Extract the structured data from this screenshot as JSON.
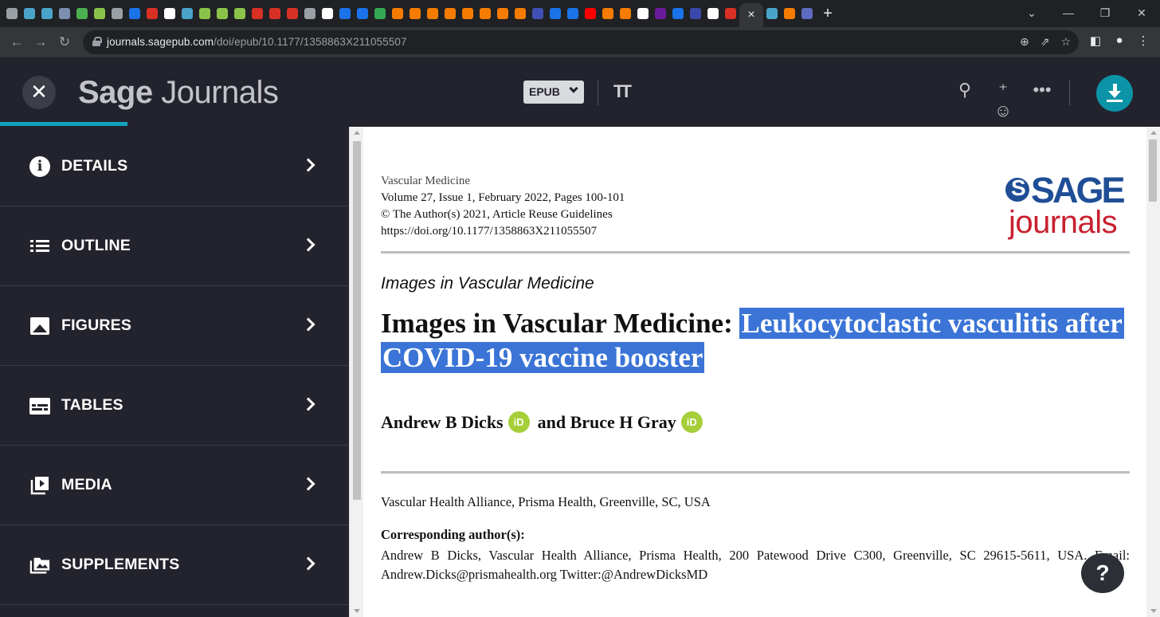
{
  "browser": {
    "active_tab_close": "×",
    "new_tab": "+",
    "url_host": "journals.sagepub.com",
    "url_path": "/doi/epub/10.1177/1358863X211055507",
    "tab_favicon_colors": [
      "#9aa0a6",
      "#4aa3c9",
      "#4aa3c9",
      "#7c8fb0",
      "#4caf50",
      "#8bc34a",
      "#9aa0a6",
      "#1a73e8",
      "#d93025",
      "#ffffff",
      "#4aa3c9",
      "#8bc34a",
      "#8bc34a",
      "#8bc34a",
      "#d93025",
      "#d93025",
      "#d93025",
      "#9aa0a6",
      "#ffffff",
      "#1a73e8",
      "#1a73e8",
      "#34a853",
      "#f57c00",
      "#f57c00",
      "#f57c00",
      "#f57c00",
      "#f57c00",
      "#f57c00",
      "#f57c00",
      "#f57c00",
      "#3f51b5",
      "#1a73e8",
      "#1a73e8",
      "#ff0000",
      "#f57c00",
      "#f57c00",
      "#ffffff",
      "#6a1b9a",
      "#1a73e8",
      "#3949ab",
      "#ffffff",
      "#d93025",
      "#4aa3c9",
      "#f57c00",
      "#5c6bc0"
    ]
  },
  "header": {
    "brand_bold": "Sage",
    "brand_rest": "Journals",
    "format_label": "EPUB",
    "font_size_label": "TT",
    "progress_fraction": 0.11,
    "accent": "#12a3bd",
    "download_color": "#0b94a8"
  },
  "sidebar": {
    "items": [
      {
        "label": "DETAILS",
        "icon": "info-icon"
      },
      {
        "label": "OUTLINE",
        "icon": "list-icon"
      },
      {
        "label": "FIGURES",
        "icon": "image-icon"
      },
      {
        "label": "TABLES",
        "icon": "table-icon"
      },
      {
        "label": "MEDIA",
        "icon": "media-icon"
      },
      {
        "label": "SUPPLEMENTS",
        "icon": "supplements-icon"
      }
    ]
  },
  "article": {
    "journal": "Vascular Medicine",
    "volume": "Volume 27, Issue 1, February 2022, Pages 100-101",
    "copyright": "© The Author(s) 2021, Article Reuse Guidelines",
    "doi": "https://doi.org/10.1177/1358863X211055507",
    "logo_top": "SAGE",
    "logo_bottom": "journals",
    "kicker": "Images in Vascular Medicine",
    "title_prefix": "Images in Vascular Medicine: ",
    "title_highlight_1": "Leukocytoclastic vasculitis after ",
    "title_highlight_2": "COVID-19 vaccine booster",
    "author_1": "Andrew B Dicks",
    "author_join": "and Bruce H Gray",
    "orcid_label": "iD",
    "affiliation": "Vascular Health Alliance, Prisma Health, Greenville, SC, USA",
    "corresponding_heading": "Corresponding author(s):",
    "corresponding_text": "Andrew B Dicks, Vascular Health Alliance, Prisma Health, 200 Patewood Drive C300, Greenville, SC 29615-5611, USA. Email: Andrew.Dicks@prismahealth.org Twitter:@AndrewDicksMD",
    "highlight_color": "#3b74d6"
  },
  "help": {
    "label": "?"
  }
}
